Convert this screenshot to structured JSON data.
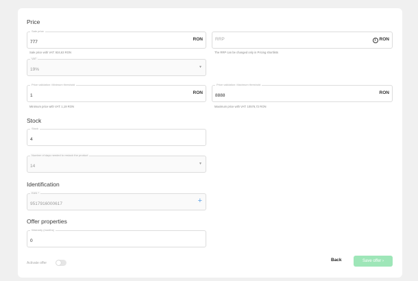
{
  "price": {
    "title": "Price",
    "sale_price": {
      "label": "Sale price",
      "value": "777",
      "currency": "RON",
      "helper": "Sale price with VAT: 924,63 RON"
    },
    "rrp": {
      "placeholder": "RRP",
      "currency": "RON",
      "helper": "The RRP can be changed only in Pricing shortlists"
    },
    "vat": {
      "label": "VAT",
      "value": "19%"
    },
    "min_price": {
      "label": "Price validation: Minimum threshold",
      "value": "1",
      "currency": "RON",
      "helper": "Minimum price with VAT: 1,19 RON"
    },
    "max_price": {
      "label": "Price validation: Maximum threshold",
      "value": "8888",
      "currency": "RON",
      "helper": "Maximum price with VAT: 10576,72 RON"
    }
  },
  "stock": {
    "title": "Stock",
    "stock_field": {
      "label": "Stock",
      "value": "4"
    },
    "handling_time": {
      "label": "Number of days needed to restock the product",
      "value": "14"
    }
  },
  "identification": {
    "title": "Identification",
    "ean": {
      "label": "EAN *",
      "value": "9517916000617"
    }
  },
  "offer_properties": {
    "title": "Offer properties",
    "warranty": {
      "label": "Warranty (months)",
      "value": "0"
    }
  },
  "footer": {
    "activate_label": "Activate offer",
    "activate_on": false,
    "back_label": "Back",
    "save_label": "Save offer ›"
  },
  "icons": {
    "info": "info-circle-icon",
    "chevron": "chevron-down-icon",
    "plus": "plus-icon"
  },
  "colors": {
    "save_button": "#9ee6b8",
    "plus_icon": "#5aa0e6"
  }
}
